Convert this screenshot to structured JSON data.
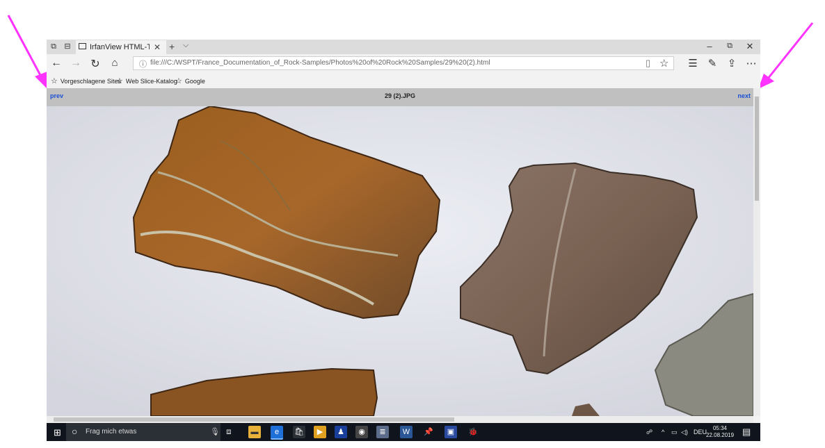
{
  "browser": {
    "tab_title": "IrfanView HTML-Thumb",
    "new_tab_symbol": "+",
    "tab_menu_symbol": "⌵",
    "close_tab_symbol": "✕",
    "url": "file:///C:/WSPT/France_Documentation_of_Rock-Samples/Photos%20of%20Rock%20Samples/29%20(2).html",
    "window_controls": [
      "–",
      "⧉",
      "✕"
    ],
    "favorites": [
      "Vorgeschlagene Sites",
      "Web Slice-Katalog",
      "Google"
    ]
  },
  "page": {
    "prev_label": "prev",
    "title": "29 (2).JPG",
    "next_label": "next"
  },
  "taskbar": {
    "search_placeholder": "Frag mich etwas",
    "language": "DEU",
    "time": "05:34",
    "date": "22.08.2019"
  },
  "icons": [
    "back-icon",
    "forward-icon",
    "refresh-icon",
    "home-icon",
    "reading-view-icon",
    "favorite-star-icon",
    "favorites-hub-icon",
    "pen-icon",
    "share-icon",
    "more-icon"
  ],
  "colors": {
    "annotation_arrow": "#ff33ff",
    "link": "#1a4fd4",
    "taskbar": "#10141c"
  }
}
